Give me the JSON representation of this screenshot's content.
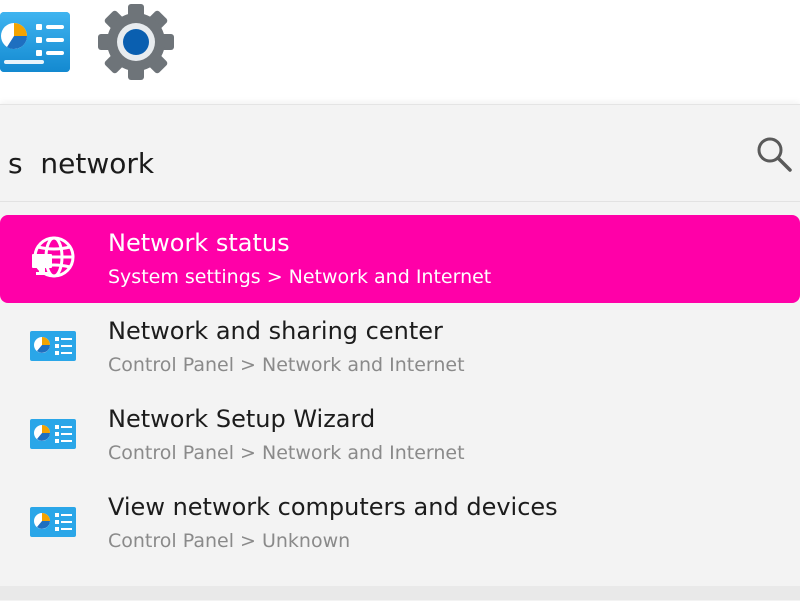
{
  "taskbar": {
    "control_panel_icon": "control-panel-icon",
    "settings_icon": "gear-icon"
  },
  "search": {
    "value": "s  network",
    "icon": "search-icon"
  },
  "results": [
    {
      "title": "Network status",
      "subtitle": "System settings > Network and Internet",
      "icon": "globe-monitor-icon",
      "selected": true
    },
    {
      "title": "Network and sharing center",
      "subtitle": "Control Panel > Network and Internet",
      "icon": "control-panel-icon",
      "selected": false
    },
    {
      "title": "Network Setup Wizard",
      "subtitle": "Control Panel > Network and Internet",
      "icon": "control-panel-icon",
      "selected": false
    },
    {
      "title": "View network computers and devices",
      "subtitle": "Control Panel > Unknown",
      "icon": "control-panel-icon",
      "selected": false
    }
  ],
  "colors": {
    "selection": "#ff00a8",
    "panel_bg": "#f3f3f3",
    "subtitle_gray": "#8a8a8a"
  }
}
